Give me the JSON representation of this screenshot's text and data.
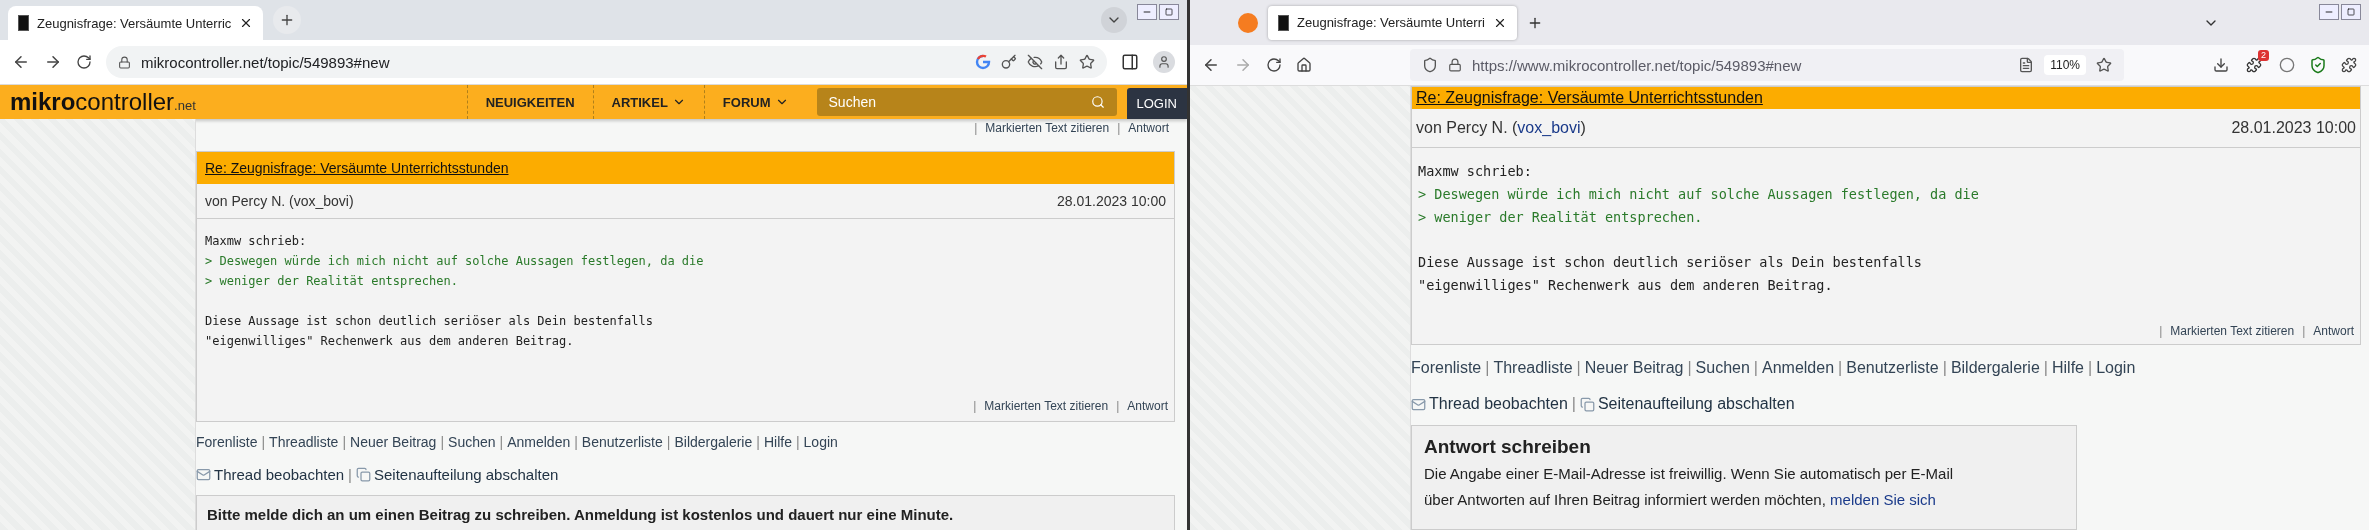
{
  "windows": [
    {
      "kind": "chrome",
      "separator": "|",
      "tab": {
        "title": "Zeugnisfrage: Versäumte Unterric",
        "selected": true
      },
      "url": "mikrocontroller.net/topic/549893#new",
      "site_header": {
        "logo_bold": "mikro",
        "logo_rest": "controller",
        "logo_suffix": ".net",
        "nav": [
          {
            "label": "NEUIGKEITEN",
            "dropdown": false
          },
          {
            "label": "ARTIKEL",
            "dropdown": true
          },
          {
            "label": "FORUM",
            "dropdown": true
          }
        ],
        "search_placeholder": "Suchen",
        "login": "LOGIN"
      },
      "previous_post_actions": [
        "Markierten Text zitieren",
        "Antwort"
      ],
      "post": {
        "title": "Re: Zeugnisfrage: Versäumte Unterrichtsstunden",
        "author": "von Percy N. (",
        "username": "vox_bovi",
        "author_end": ")",
        "date": "28.01.2023 10:00",
        "paragraphs": [
          [
            {
              "kind": "text",
              "text": "Maxmw schrieb:"
            },
            {
              "kind": "quote",
              "text": "> Deswegen würde ich mich nicht auf solche Aussagen festlegen, da die"
            },
            {
              "kind": "quote",
              "text": "> weniger der Realität entsprechen."
            }
          ],
          [
            {
              "kind": "text",
              "text": "Diese Aussage ist schon deutlich seriöser als Dein bestenfalls"
            },
            {
              "kind": "text",
              "text": "\"eigenwilliges\" Rechenwerk aus dem anderen Beitrag."
            }
          ]
        ],
        "actions": [
          "Markierten Text zitieren",
          "Antwort"
        ]
      },
      "footer_links": [
        "Forenliste",
        "Threadliste",
        "Neuer Beitrag",
        "Suchen",
        "Anmelden",
        "Benutzerliste",
        "Bildergalerie",
        "Hilfe",
        "Login"
      ],
      "thread_actions": [
        {
          "kind": "watch",
          "label": "Thread beobachten"
        },
        {
          "kind": "pages",
          "label": "Seitenaufteilung abschalten"
        }
      ],
      "notice": {
        "kind": "login",
        "heading": "Bitte melde dich an um einen Beitrag zu schreiben. Anmeldung ist kostenlos und dauert nur eine Minute."
      }
    },
    {
      "kind": "firefox",
      "separator": "|",
      "tab": {
        "title": "Zeugnisfrage: Versäumte Unterri",
        "selected": true
      },
      "url": "https://www.mikrocontroller.net/topic/549893#new",
      "zoom": "110%",
      "extension_badge": "2",
      "post": {
        "title": "Re: Zeugnisfrage: Versäumte Unterrichtsstunden",
        "author": "von Percy N. (",
        "username": "vox_bovi",
        "author_end": ")",
        "date": "28.01.2023 10:00",
        "paragraphs": [
          [
            {
              "kind": "text",
              "text": "Maxmw schrieb:"
            },
            {
              "kind": "quote",
              "text": "> Deswegen würde ich mich nicht auf solche Aussagen festlegen, da die"
            },
            {
              "kind": "quote",
              "text": "> weniger der Realität entsprechen."
            }
          ],
          [
            {
              "kind": "text",
              "text": "Diese Aussage ist schon deutlich seriöser als Dein bestenfalls"
            },
            {
              "kind": "text",
              "text": "\"eigenwilliges\" Rechenwerk aus dem anderen Beitrag."
            }
          ]
        ],
        "actions": [
          "Markierten Text zitieren",
          "Antwort"
        ]
      },
      "footer_links": [
        "Forenliste",
        "Threadliste",
        "Neuer Beitrag",
        "Suchen",
        "Anmelden",
        "Benutzerliste",
        "Bildergalerie",
        "Hilfe",
        "Login"
      ],
      "thread_actions": [
        {
          "kind": "watch",
          "label": "Thread beobachten"
        },
        {
          "kind": "pages",
          "label": "Seitenaufteilung abschalten"
        }
      ],
      "notice": {
        "kind": "reply",
        "heading": "Antwort schreiben",
        "lines": [
          "Die Angabe einer E-Mail-Adresse ist freiwillig. Wenn Sie automatisch per E-Mail",
          "über Antworten auf Ihren Beitrag informiert werden möchten,"
        ],
        "link": "melden Sie sich"
      }
    }
  ]
}
